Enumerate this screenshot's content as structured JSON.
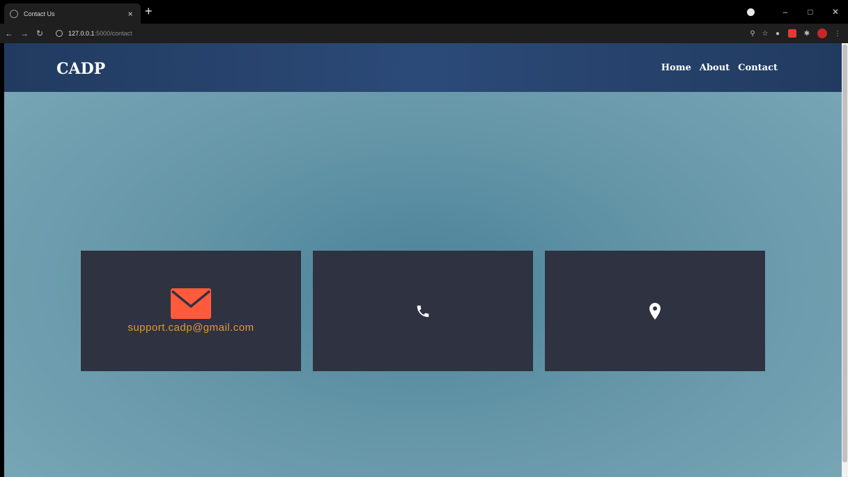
{
  "browser": {
    "tab_title": "Contact Us",
    "tab_close": "×",
    "new_tab": "+",
    "url_host": "127.0.0.1",
    "url_path": ":5000/contact"
  },
  "site": {
    "brand": "CADP",
    "nav": [
      "Home",
      "About",
      "Contact"
    ]
  },
  "contact": {
    "email": "support.cadp@gmail.com",
    "email_icon": "envelope-icon",
    "phone_icon": "phone-icon",
    "location_icon": "location-pin-icon",
    "accent_color": "#ff5a3c",
    "email_text_color": "#e39a2d",
    "card_color": "#2f3240"
  }
}
